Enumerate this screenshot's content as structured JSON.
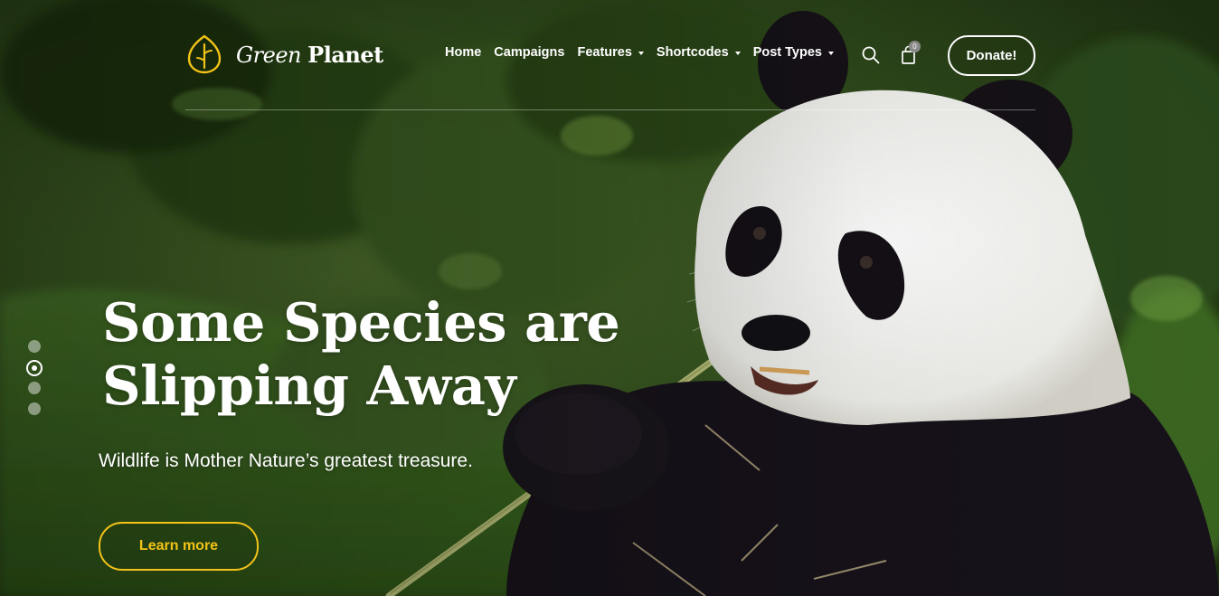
{
  "brand": {
    "name_light": "Green",
    "name_bold": "Planet",
    "logo_icon": "leaf-icon",
    "accent_color": "#f2c318"
  },
  "nav": {
    "items": [
      {
        "label": "Home",
        "has_dropdown": false
      },
      {
        "label": "Campaigns",
        "has_dropdown": false
      },
      {
        "label": "Features",
        "has_dropdown": true
      },
      {
        "label": "Shortcodes",
        "has_dropdown": true
      },
      {
        "label": "Post Types",
        "has_dropdown": true
      }
    ],
    "search_icon": "search-icon",
    "cart_icon": "shopping-bag-icon",
    "cart_count": "0",
    "donate_label": "Donate!"
  },
  "hero": {
    "headline_line1": "Some Species are",
    "headline_line2": "Slipping Away",
    "subtitle": "Wildlife is Mother Nature’s greatest treasure.",
    "cta_label": "Learn more"
  },
  "slider": {
    "slide_count": 4,
    "active_index": 1
  }
}
